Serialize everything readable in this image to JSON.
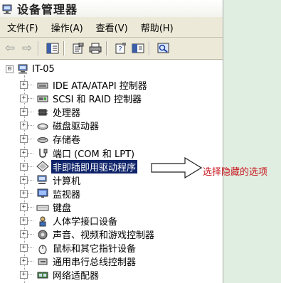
{
  "window": {
    "title": "设备管理器"
  },
  "menu": {
    "items": [
      "文件(F)",
      "操作(A)",
      "查看(V)",
      "帮助(H)"
    ]
  },
  "toolbar": {
    "buttons": [
      "back-arrow-icon",
      "forward-arrow-icon",
      "show-hide-tree-icon",
      "properties-icon",
      "print-icon",
      "help-icon",
      "export-list-icon",
      "scan-hardware-icon"
    ]
  },
  "tree": {
    "root": {
      "label": "IT-05",
      "expander": "⊟"
    },
    "nodes": [
      {
        "label": "IDE ATA/ATAPI 控制器",
        "icon": "ide-controller-icon"
      },
      {
        "label": "SCSI 和 RAID 控制器",
        "icon": "scsi-controller-icon"
      },
      {
        "label": "处理器",
        "icon": "processor-icon"
      },
      {
        "label": "磁盘驱动器",
        "icon": "disk-drive-icon"
      },
      {
        "label": "存储卷",
        "icon": "storage-volume-icon"
      },
      {
        "label": "端口 (COM 和 LPT)",
        "icon": "port-icon"
      },
      {
        "label": "非即插即用驱动程序",
        "icon": "non-pnp-driver-icon",
        "selected": true
      },
      {
        "label": "计算机",
        "icon": "computer-icon"
      },
      {
        "label": "监视器",
        "icon": "monitor-icon"
      },
      {
        "label": "键盘",
        "icon": "keyboard-icon"
      },
      {
        "label": "人体学接口设备",
        "icon": "hid-icon"
      },
      {
        "label": "声音、视频和游戏控制器",
        "icon": "sound-icon"
      },
      {
        "label": "鼠标和其它指针设备",
        "icon": "mouse-icon"
      },
      {
        "label": "通用串行总线控制器",
        "icon": "usb-icon"
      },
      {
        "label": "网络适配器",
        "icon": "network-adapter-icon"
      }
    ]
  },
  "annotation": {
    "text": "选择隐藏的选项",
    "color": "#c8141e"
  }
}
